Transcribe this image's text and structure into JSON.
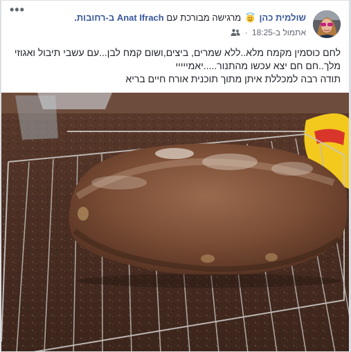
{
  "post": {
    "author_name": "שולמית כהן",
    "feeling_text": "מרגישה מבורכת עם",
    "tagged_name": "Anat Ifrach",
    "location_text": "ב-רחובות.",
    "timestamp": "אתמול ב-18:25",
    "separator": "·",
    "privacy_icon": "people-icon",
    "feeling_icon": "smiling-face-with-halo-icon",
    "more_label": "•••",
    "body_lines": [
      "לחם כוסמין מקמח מלא..ללא שמרים, ביצים,ושום קמח לבן...עם עשבי תיבול ואגוזי",
      "מלך..חם חם יצא עכשו מהתנור.....יאמייייי",
      "תודה רבה למכללת איתן מתוך תוכנית אורח חיים בריא"
    ],
    "photo_subject": "loaf-of-bread-on-cooling-rack"
  },
  "colors": {
    "link": "#385898",
    "text": "#1d2129",
    "meta": "#606770"
  }
}
